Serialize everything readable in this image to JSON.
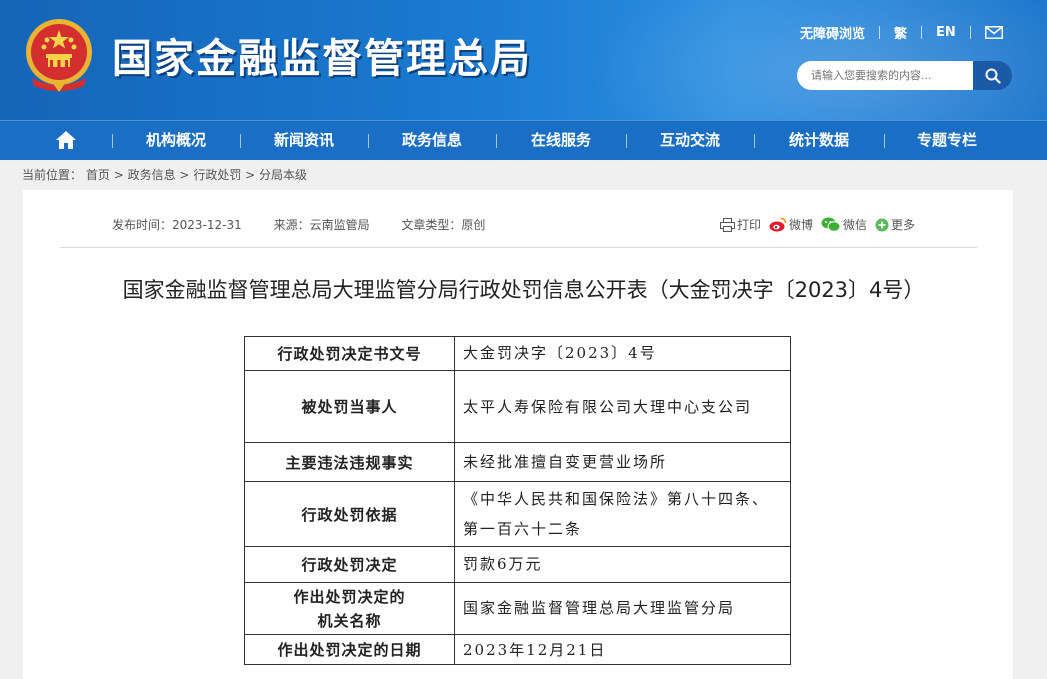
{
  "header": {
    "site_title": "国家金融监督管理总局",
    "links": {
      "accessible": "无障碍浏览",
      "traditional": "繁",
      "english": "EN"
    },
    "search_placeholder": "请输入您要搜索的内容..."
  },
  "nav": {
    "items": [
      "机构概况",
      "新闻资讯",
      "政务信息",
      "在线服务",
      "互动交流",
      "统计数据",
      "专题专栏"
    ]
  },
  "breadcrumb": {
    "prefix": "当前位置：",
    "items": [
      "首页",
      "政务信息",
      "行政处罚",
      "分局本级"
    ],
    "separator": ">"
  },
  "article": {
    "publish_time": "发布时间：2023-12-31",
    "source": "来源：云南监管局",
    "type": "文章类型：原创",
    "share": {
      "print": "打印",
      "weibo": "微博",
      "wechat": "微信",
      "more": "更多"
    },
    "title": "国家金融监督管理总局大理监管分局行政处罚信息公开表（大金罚决字〔2023〕4号）"
  },
  "penalty_table": [
    {
      "label": "行政处罚决定书文号",
      "value": "大金罚决字〔2023〕4号"
    },
    {
      "label": "被处罚当事人",
      "value": "太平人寿保险有限公司大理中心支公司"
    },
    {
      "label": "主要违法违规事实",
      "value": "未经批准擅自变更营业场所"
    },
    {
      "label": "行政处罚依据",
      "value": "《中华人民共和国保险法》第八十四条、第一百六十二条"
    },
    {
      "label": "行政处罚决定",
      "value": "罚款6万元"
    },
    {
      "label": "作出处罚决定的机关名称",
      "label_line1": "作出处罚决定的",
      "label_line2": "机关名称",
      "value": "国家金融监督管理总局大理监管分局"
    },
    {
      "label": "作出处罚决定的日期",
      "value": "2023年12月21日"
    }
  ]
}
